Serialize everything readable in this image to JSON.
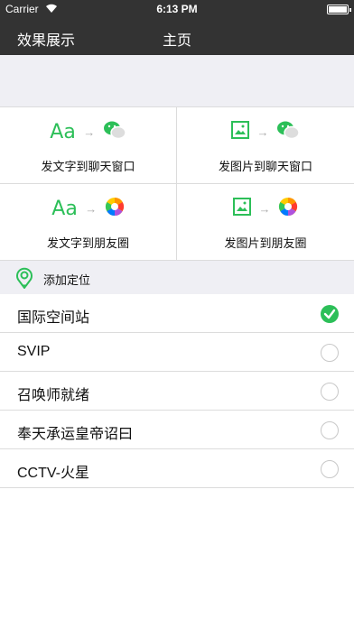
{
  "status": {
    "carrier": "Carrier",
    "time": "6:13 PM"
  },
  "nav": {
    "back_label": "效果展示",
    "title": "主页"
  },
  "grid": [
    {
      "label": "发文字到聊天窗口",
      "from_icon": "text-aa-icon",
      "to_icon": "wechat-icon"
    },
    {
      "label": "发图片到聊天窗口",
      "from_icon": "image-icon",
      "to_icon": "wechat-icon"
    },
    {
      "label": "发文字到朋友圈",
      "from_icon": "text-aa-icon",
      "to_icon": "moments-icon"
    },
    {
      "label": "发图片到朋友圈",
      "from_icon": "image-icon",
      "to_icon": "moments-icon"
    }
  ],
  "aa_text": "Aa",
  "arrow_glyph": "→",
  "location": {
    "label": "添加定位"
  },
  "options": [
    {
      "label": "国际空间站",
      "selected": true
    },
    {
      "label": "SVIP",
      "selected": false
    },
    {
      "label": "召唤师就绪",
      "selected": false
    },
    {
      "label": "奉天承运皇帝诏曰",
      "selected": false
    },
    {
      "label": "CCTV-火星",
      "selected": false
    }
  ],
  "colors": {
    "accent": "#2cbf58",
    "bar": "#333333",
    "band": "#efeff4"
  }
}
